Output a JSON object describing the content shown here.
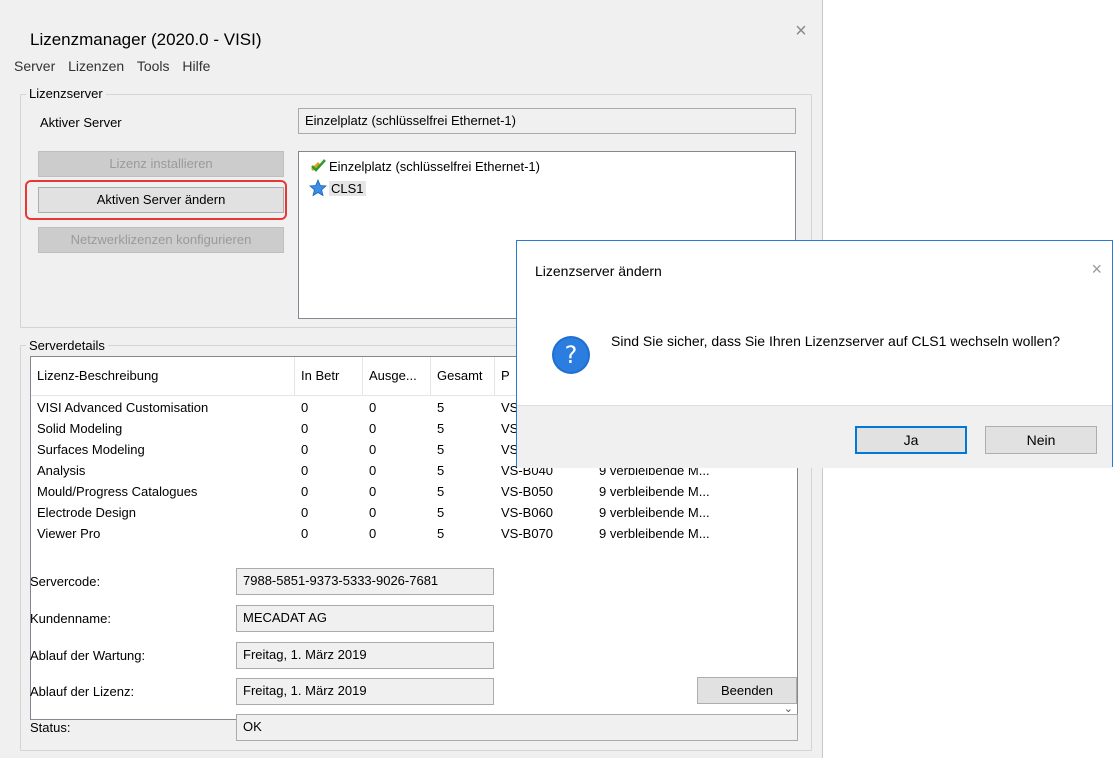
{
  "window": {
    "title": "Lizenzmanager (2020.0 - VISI)",
    "close_glyph": "×",
    "menu": [
      "Server",
      "Lizenzen",
      "Tools",
      "Hilfe"
    ]
  },
  "lizenzserver": {
    "group_label": "Lizenzserver",
    "active_server_label": "Aktiver Server",
    "active_server_value": "Einzelplatz (schlüsselfrei Ethernet-1)",
    "buttons": {
      "install": "Lizenz installieren",
      "change": "Aktiven Server ändern",
      "network": "Netzwerklizenzen konfigurieren"
    },
    "servers": [
      {
        "label": "Einzelplatz (schlüsselfrei Ethernet-1)",
        "icon": "check-key-icon"
      },
      {
        "label": "CLS1",
        "icon": "star-icon"
      }
    ]
  },
  "serverdetails": {
    "group_label": "Serverdetails",
    "columns": [
      "Lizenz-Beschreibung",
      "In Betr",
      "Ausge...",
      "Gesamt",
      "P"
    ],
    "rows": [
      {
        "desc": "VISI Advanced Customisation",
        "inbetr": "0",
        "ausge": "0",
        "gesamt": "5",
        "p": "VS",
        "extra": ""
      },
      {
        "desc": "Solid Modeling",
        "inbetr": "0",
        "ausge": "0",
        "gesamt": "5",
        "p": "VS",
        "extra": ""
      },
      {
        "desc": "Surfaces Modeling",
        "inbetr": "0",
        "ausge": "0",
        "gesamt": "5",
        "p": "VS",
        "extra": ""
      },
      {
        "desc": "Analysis",
        "inbetr": "0",
        "ausge": "0",
        "gesamt": "5",
        "p": "VS-B040",
        "extra": "9 verbleibende M..."
      },
      {
        "desc": "Mould/Progress Catalogues",
        "inbetr": "0",
        "ausge": "0",
        "gesamt": "5",
        "p": "VS-B050",
        "extra": "9 verbleibende M..."
      },
      {
        "desc": "Electrode Design",
        "inbetr": "0",
        "ausge": "0",
        "gesamt": "5",
        "p": "VS-B060",
        "extra": "9 verbleibende M..."
      },
      {
        "desc": "Viewer Pro",
        "inbetr": "0",
        "ausge": "0",
        "gesamt": "5",
        "p": "VS-B070",
        "extra": "9 verbleibende M..."
      }
    ],
    "servercode_label": "Servercode:",
    "servercode": "7988-5851-9373-5333-9026-7681",
    "kunde_label": "Kundenname:",
    "kunde": "MECADAT AG",
    "wartung_label": "Ablauf der Wartung:",
    "wartung": "Freitag, 1. März 2019",
    "lizenz_label": "Ablauf der Lizenz:",
    "lizenz": "Freitag, 1. März 2019",
    "status_label": "Status:",
    "status": "OK",
    "exit_button": "Beenden"
  },
  "dialog": {
    "title": "Lizenzserver ändern",
    "close_glyph": "×",
    "message": "Sind Sie sicher, dass Sie Ihren Lizenzserver auf CLS1 wechseln wollen?",
    "yes": "Ja",
    "no": "Nein",
    "accent": "#0078d7"
  }
}
